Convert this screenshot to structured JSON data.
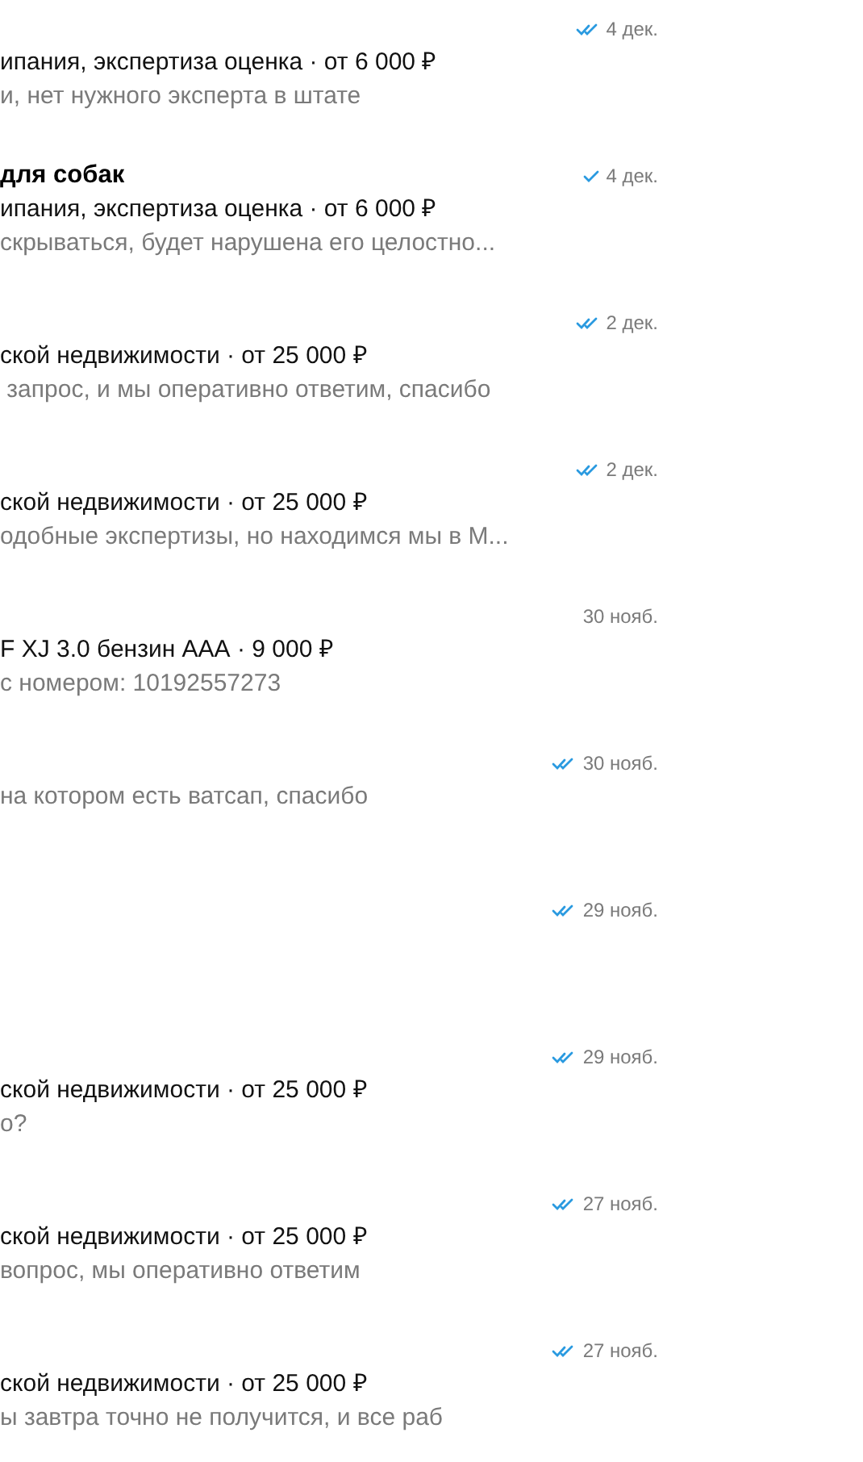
{
  "chats": [
    {
      "date": "4 дек.",
      "sent": true,
      "read": true,
      "subtitle": "ипания, экспертиза оценка · от 6 000 ₽",
      "preview": "и, нет нужного эксперта в штате"
    },
    {
      "title": "для собак",
      "date": "4 дек.",
      "sent": true,
      "read": false,
      "subtitle": "ипания, экспертиза оценка · от 6 000 ₽",
      "preview": "скрываться, будет нарушена его целостно..."
    },
    {
      "date": "2 дек.",
      "sent": true,
      "read": true,
      "subtitle": "ской недвижимости · от 25 000 ₽",
      "preview": " запрос, и мы оперативно ответим, спасибо"
    },
    {
      "date": "2 дек.",
      "sent": true,
      "read": true,
      "subtitle": "ской недвижимости · от 25 000 ₽",
      "preview": "одобные экспертизы, но находимся мы в М..."
    },
    {
      "date": "30 нояб.",
      "sent": false,
      "subtitle": "F XJ 3.0 бензин ААА · 9 000 ₽",
      "preview": "с номером: 10192557273"
    },
    {
      "date": "30 нояб.",
      "sent": true,
      "read": true,
      "preview": "на котором есть ватсап, спасибо"
    },
    {
      "date": "29 нояб.",
      "sent": true,
      "read": true
    },
    {
      "date": "29 нояб.",
      "sent": true,
      "read": true,
      "subtitle": "ской недвижимости · от 25 000 ₽",
      "preview": "о?"
    },
    {
      "date": "27 нояб.",
      "sent": true,
      "read": true,
      "subtitle": "ской недвижимости · от 25 000 ₽",
      "preview": "вопрос, мы оперативно ответим"
    },
    {
      "date": "27 нояб.",
      "sent": true,
      "read": true,
      "subtitle": "ской недвижимости · от 25 000 ₽",
      "preview": "ы завтра точно не получится, и все раб"
    }
  ]
}
